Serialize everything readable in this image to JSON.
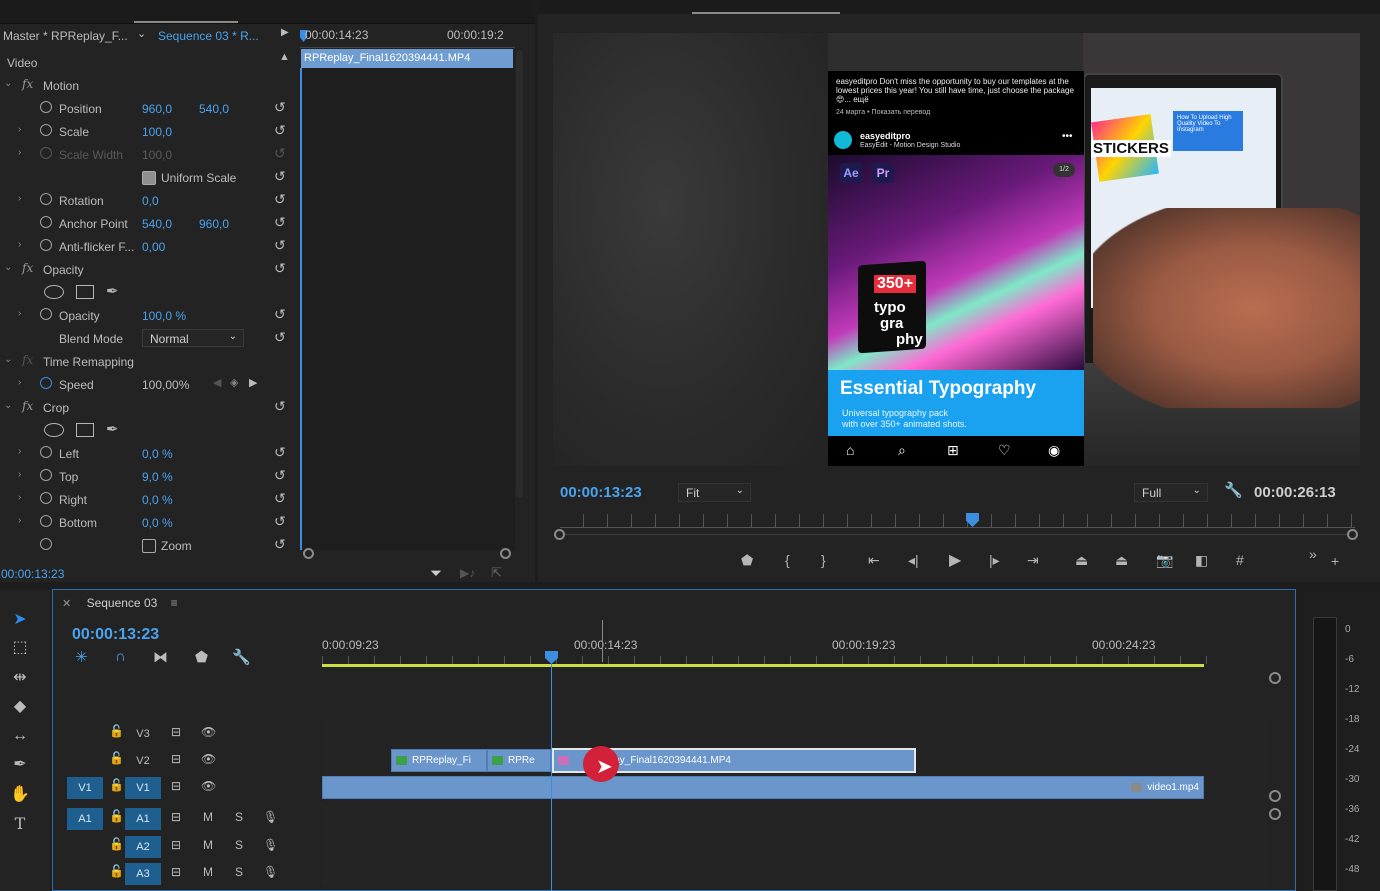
{
  "effect_controls": {
    "master_label": "Master * RPReplay_F...",
    "sequence_label": "Sequence 03 * R...",
    "time_start": "00:00:14:23",
    "time_end": "00:00:19:2",
    "clip_name": "RPReplay_Final1620394441.MP4",
    "footer_time": "00:00:13:23",
    "section_video": "Video",
    "motion": {
      "title": "Motion",
      "position_label": "Position",
      "position_x": "960,0",
      "position_y": "540,0",
      "scale_label": "Scale",
      "scale_value": "100,0",
      "scale_width_label": "Scale Width",
      "scale_width_value": "100,0",
      "uniform_scale_label": "Uniform Scale",
      "rotation_label": "Rotation",
      "rotation_value": "0,0",
      "anchor_label": "Anchor Point",
      "anchor_x": "540,0",
      "anchor_y": "960,0",
      "antiflicker_label": "Anti-flicker F...",
      "antiflicker_value": "0,00"
    },
    "opacity": {
      "title": "Opacity",
      "opacity_label": "Opacity",
      "opacity_value": "100,0 %",
      "blend_label": "Blend Mode",
      "blend_value": "Normal"
    },
    "time_remapping": {
      "title": "Time Remapping",
      "speed_label": "Speed",
      "speed_value": "100,00%"
    },
    "crop": {
      "title": "Crop",
      "left_label": "Left",
      "left_value": "0,0 %",
      "top_label": "Top",
      "top_value": "9,0 %",
      "right_label": "Right",
      "right_value": "0,0 %",
      "bottom_label": "Bottom",
      "bottom_value": "0,0 %",
      "zoom_label": "Zoom"
    }
  },
  "program_monitor": {
    "current_time": "00:00:13:23",
    "fit_value": "Fit",
    "quality_value": "Full",
    "duration": "00:00:26:13",
    "video": {
      "caption": "easyeditpro Don't miss the opportunity to buy our templates at the lowest prices this year! You still have time, just choose the package 😍... ещё",
      "date": "24 марта • Показать перевод",
      "username": "easyeditpro",
      "subtitle": "EasyEdit - Motion Design Studio",
      "badge_ae": "Ae",
      "badge_pr": "Pr",
      "page_indicator": "1/2",
      "box_count": "350+",
      "box_word_1": "typo",
      "box_word_2": "gra",
      "box_word_3": "phy",
      "title": "Essential Typography",
      "tagline_1": "Universal typography pack",
      "tagline_2": "with over 350+ animated shots.",
      "laptop_stickers": "STICKERS",
      "laptop_card": "How To Upload High Quality Video To Instagram"
    }
  },
  "timeline": {
    "sequence_name": "Sequence 03",
    "current_time": "00:00:13:23",
    "ruler_labels": [
      "0:00:09:23",
      "00:00:14:23",
      "00:00:19:23",
      "00:00:24:23"
    ],
    "tracks": {
      "v3": "V3",
      "v2": "V2",
      "v1": "V1",
      "a1": "A1",
      "a2": "A2",
      "a3": "A3",
      "src_v1": "V1",
      "src_a1": "A1",
      "mute": "M",
      "solo": "S"
    },
    "clips": {
      "v2_clip1": "RPReplay_Fi",
      "v2_clip2": "RPRe",
      "v2_clip3": "lay_Final1620394441.MP4",
      "v1_clip": "video1.mp4"
    }
  },
  "audio_meter": {
    "labels": [
      "0",
      "-6",
      "-12",
      "-18",
      "-24",
      "-30",
      "-36",
      "-42",
      "-48"
    ]
  },
  "colors": {
    "accent_blue": "#4aa3ef",
    "playhead": "#3d8ee0",
    "clip_blue": "#6a96cc",
    "work_area": "#cbe03c"
  }
}
